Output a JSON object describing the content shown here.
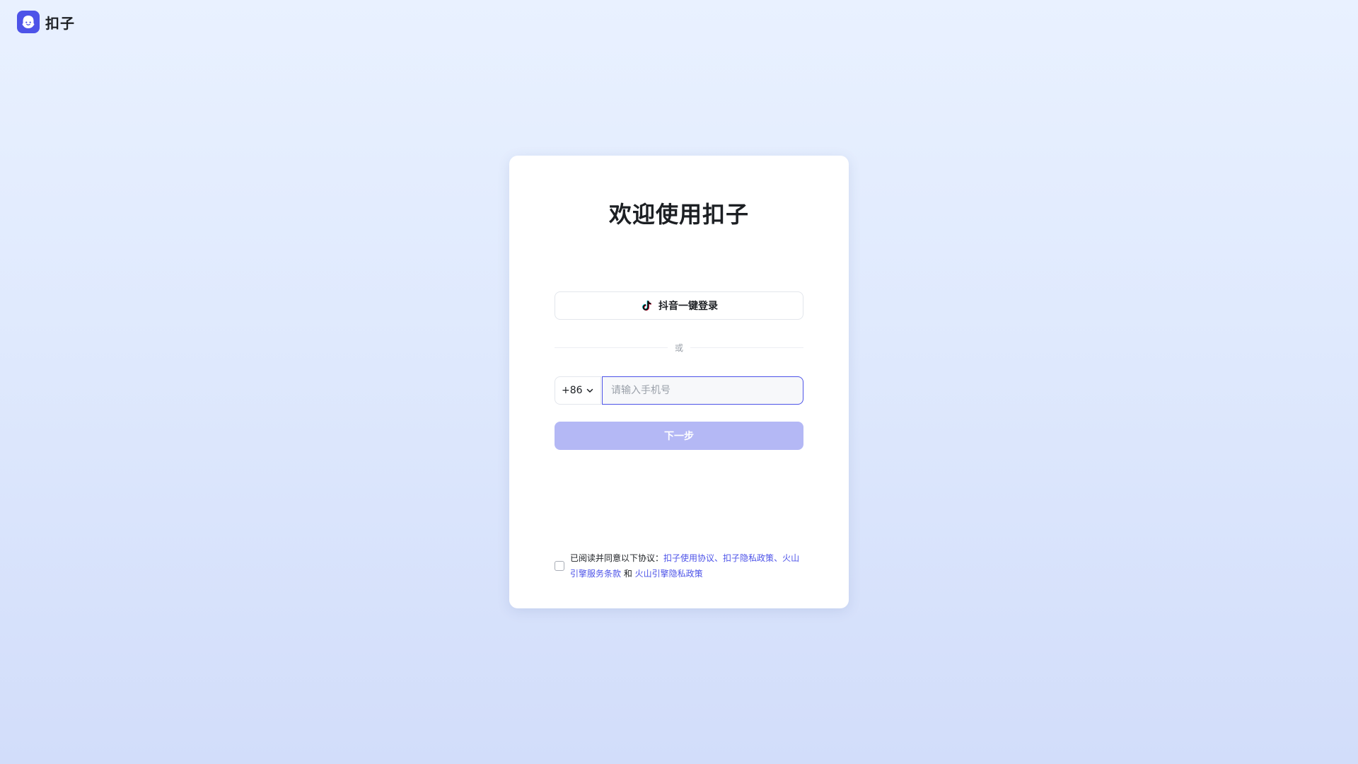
{
  "brand": {
    "name": "扣子",
    "logo_icon": "coze-logo-icon",
    "accent_color": "#4d53e8"
  },
  "login": {
    "title": "欢迎使用扣子",
    "douyin_button": {
      "label": "抖音一键登录",
      "icon": "tiktok-icon"
    },
    "divider_text": "或",
    "phone": {
      "country_code": "+86",
      "placeholder": "请输入手机号",
      "value": ""
    },
    "next_button": {
      "label": "下一步",
      "color": "#b4b8f5"
    },
    "agreement": {
      "checked": false,
      "prefix": "已阅读并同意以下协议：",
      "link1": "扣子使用协议",
      "sep1": "、",
      "link2": "扣子隐私政策",
      "sep2": "、",
      "link3": "火山引擎服务条款",
      "conjunction": " 和 ",
      "link4": "火山引擎隐私政策"
    }
  }
}
